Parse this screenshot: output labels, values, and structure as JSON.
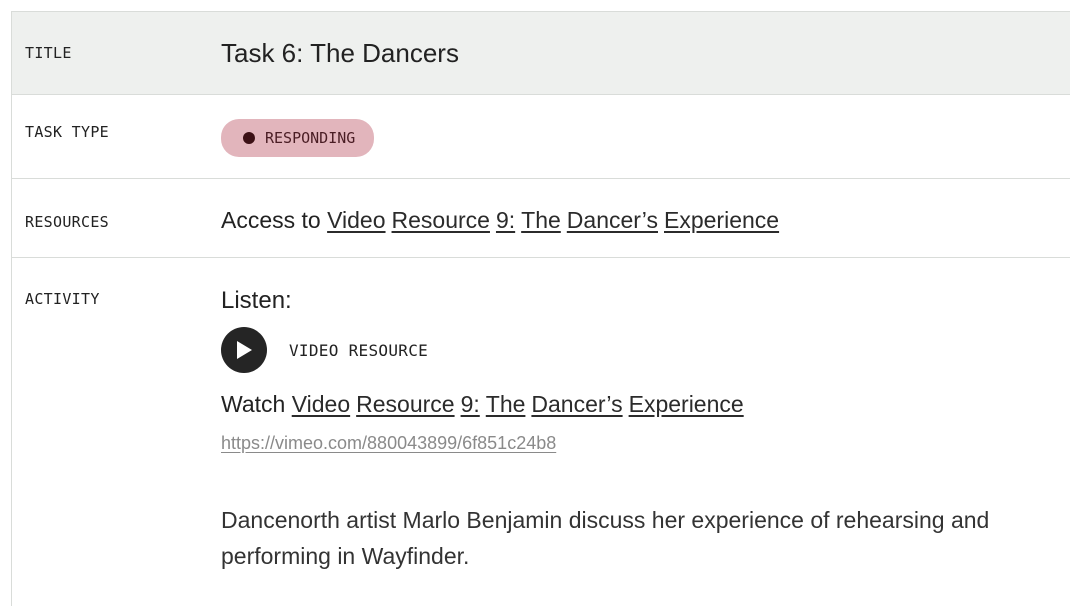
{
  "rows": {
    "title": {
      "label": "TITLE",
      "value": "Task 6: The Dancers"
    },
    "task_type": {
      "label": "TASK TYPE",
      "badge": "RESPONDING",
      "badge_color": "#e2b5bc"
    },
    "resources": {
      "label": "RESOURCES",
      "prefix": "Access to",
      "links": [
        "Video",
        "Resource",
        "9:",
        "The",
        "Dancer’s",
        "Experience"
      ]
    },
    "activity": {
      "label": "ACTIVITY",
      "heading": "Listen:",
      "video_label": "VIDEO RESOURCE",
      "play_icon": "play-icon",
      "watch_prefix": "Watch",
      "watch_links": [
        "Video",
        "Resource",
        "9:",
        "The",
        "Dancer’s",
        "Experience"
      ],
      "url": "https://vimeo.com/880043899/6f851c24b8",
      "description": "Dancenorth artist Marlo Benjamin discuss her experience of rehearsing and performing in Wayfinder."
    }
  }
}
